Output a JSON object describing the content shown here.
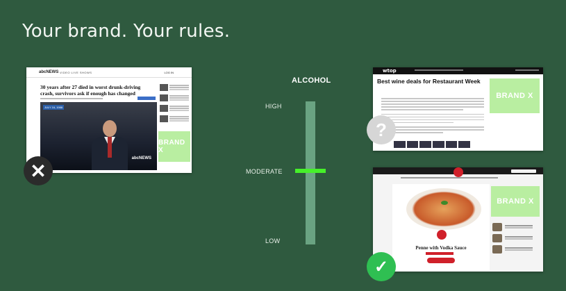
{
  "slide": {
    "title": "Your brand. Your rules."
  },
  "slider": {
    "title": "ALCOHOL",
    "levels": {
      "high": "HIGH",
      "moderate": "MODERATE",
      "low": "LOW"
    },
    "selected_level": "MODERATE",
    "marker_color": "#46f02a"
  },
  "sites": {
    "left": {
      "logo": "abcNEWS",
      "nav": "VIDEO   LIVE   SHOWS",
      "login": "LOG IN",
      "headline": "30 years after 27 died in worst drunk-driving crash, survivors ask if enough has changed",
      "video_date": "JULY 16, 1988",
      "video_mark": "abcNEWS",
      "brand_label": "BRAND X",
      "verdict": "rejected",
      "verdict_icon": "close-icon"
    },
    "right_top": {
      "logo": "wtop",
      "headline": "Best wine deals for Restaurant Week",
      "brand_label": "BRAND X",
      "verdict": "uncertain",
      "verdict_icon": "question-icon"
    },
    "right_bottom": {
      "logo": "food",
      "recipe_title": "Penne with Vodka Sauce",
      "brand_label": "BRAND X",
      "verdict": "approved",
      "verdict_icon": "check-icon"
    }
  },
  "colors": {
    "background": "#2f5a3f",
    "brand_tile": "#b9eea1",
    "check_badge": "#2fbf52",
    "x_badge": "#2b2b2b",
    "question_badge": "#d6d6d6"
  }
}
